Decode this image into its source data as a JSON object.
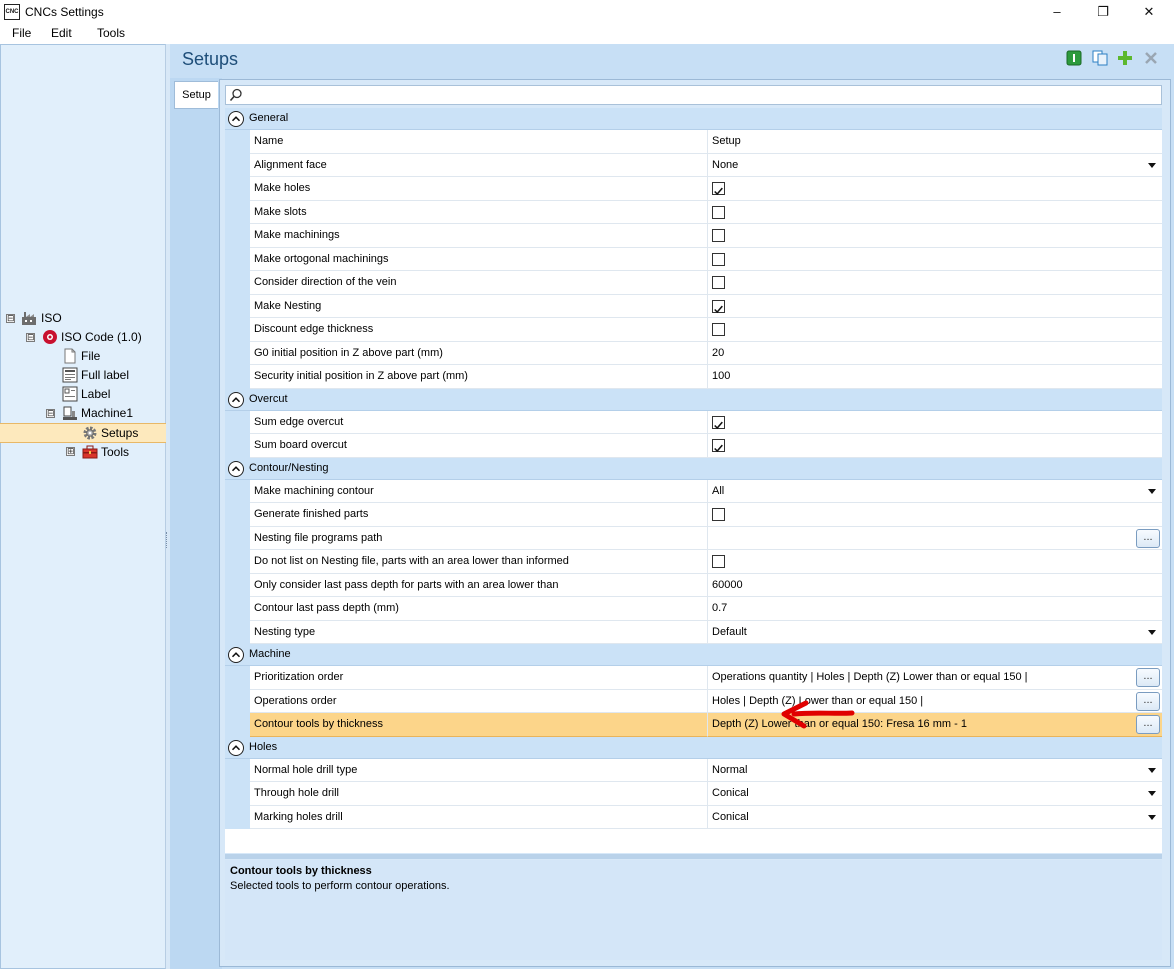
{
  "window": {
    "title": "CNCs Settings",
    "icon_text": "CNC",
    "controls": [
      "–",
      "❐",
      "✕"
    ]
  },
  "menu": [
    "File",
    "Edit",
    "Tools"
  ],
  "tree": {
    "nodes": [
      {
        "label": "ISO",
        "expander": "⊟"
      },
      {
        "label": "ISO Code (1.0)",
        "expander": "⊟"
      },
      {
        "label": "File"
      },
      {
        "label": "Full label"
      },
      {
        "label": "Label"
      },
      {
        "label": "Machine1",
        "expander": "⊟"
      },
      {
        "label": "Setups"
      },
      {
        "label": "Tools",
        "expander": "⊞"
      }
    ]
  },
  "main": {
    "title": "Setups",
    "tab_label": "Setup",
    "search_placeholder": ""
  },
  "grid": {
    "categories": [
      {
        "label": "General",
        "rows": [
          {
            "name": "Name",
            "value": "Setup",
            "kind": "text"
          },
          {
            "name": "Alignment face",
            "value": "None",
            "kind": "dropdown"
          },
          {
            "name": "Make holes",
            "checked": true,
            "kind": "checkbox"
          },
          {
            "name": "Make slots",
            "checked": false,
            "kind": "checkbox"
          },
          {
            "name": "Make machinings",
            "checked": false,
            "kind": "checkbox"
          },
          {
            "name": "Make ortogonal machinings",
            "checked": false,
            "kind": "checkbox"
          },
          {
            "name": "Consider direction of the vein",
            "checked": false,
            "kind": "checkbox"
          },
          {
            "name": "Make Nesting",
            "checked": true,
            "kind": "checkbox"
          },
          {
            "name": "Discount edge thickness",
            "checked": false,
            "kind": "checkbox"
          },
          {
            "name": "G0 initial position in Z above part (mm)",
            "value": "20",
            "kind": "text"
          },
          {
            "name": "Security initial position in Z above part (mm)",
            "value": "100",
            "kind": "text"
          }
        ]
      },
      {
        "label": "Overcut",
        "rows": [
          {
            "name": "Sum edge overcut",
            "checked": true,
            "kind": "checkbox"
          },
          {
            "name": "Sum board overcut",
            "checked": true,
            "kind": "checkbox"
          }
        ]
      },
      {
        "label": "Contour/Nesting",
        "rows": [
          {
            "name": "Make machining contour",
            "value": "All",
            "kind": "dropdown"
          },
          {
            "name": "Generate finished parts",
            "checked": false,
            "kind": "checkbox"
          },
          {
            "name": "Nesting file programs path",
            "value": "",
            "kind": "ellipsis"
          },
          {
            "name": "Do not list on Nesting file, parts with an area lower than informed",
            "checked": false,
            "kind": "checkbox"
          },
          {
            "name": "Only consider last pass depth for parts with an area lower than",
            "value": "60000",
            "kind": "text"
          },
          {
            "name": "Contour last pass depth (mm)",
            "value": "0.7",
            "kind": "text"
          },
          {
            "name": "Nesting type",
            "value": "Default",
            "kind": "dropdown"
          }
        ]
      },
      {
        "label": "Machine",
        "rows": [
          {
            "name": "Prioritization order",
            "value": "Operations quantity | Holes | Depth (Z) Lower than or equal 150 |",
            "kind": "ellipsis"
          },
          {
            "name": "Operations order",
            "value": "Holes | Depth (Z) Lower than or equal 150 |",
            "kind": "ellipsis"
          },
          {
            "name": "Contour tools by thickness",
            "value": "Depth (Z) Lower than or equal 150: Fresa 16 mm - 1",
            "kind": "ellipsis",
            "selected": true
          }
        ]
      },
      {
        "label": "Holes",
        "rows": [
          {
            "name": "Normal hole drill type",
            "value": "Normal",
            "kind": "dropdown"
          },
          {
            "name": "Through hole drill",
            "value": "Conical",
            "kind": "dropdown"
          },
          {
            "name": "Marking holes drill",
            "value": "Conical",
            "kind": "dropdown"
          }
        ]
      }
    ],
    "ellipsis_label": "..."
  },
  "description": {
    "title": "Contour tools by thickness",
    "text": "Selected tools to perform contour operations."
  },
  "colors": {
    "selection": "#fcd58a",
    "category": "#cbe2f7",
    "accent_arrow": "#e00000"
  }
}
